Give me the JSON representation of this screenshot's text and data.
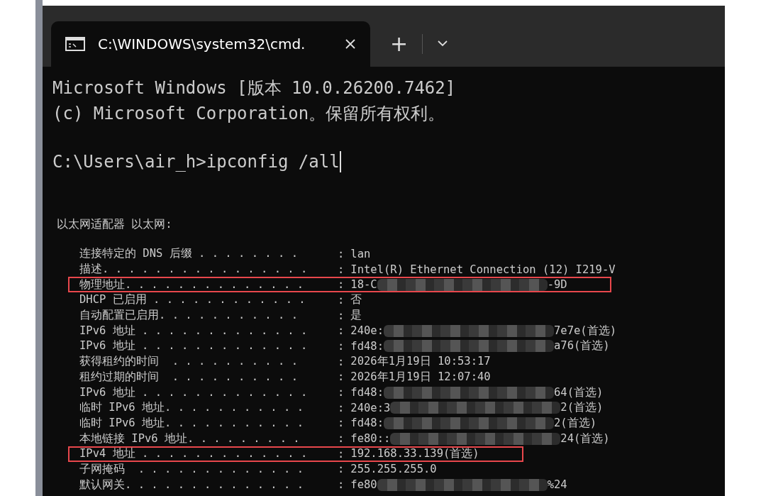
{
  "window": {
    "tab": {
      "title": "C:\\WINDOWS\\system32\\cmd.",
      "selected": true
    },
    "new_tab_button": "+"
  },
  "console": {
    "lines": [
      "Microsoft Windows [版本 10.0.26200.7462]",
      "(c) Microsoft Corporation。保留所有权利。"
    ],
    "prompt": "C:\\Users\\air_h>ipconfig /all"
  },
  "output": {
    "heading": "以太网适配器 以太网:",
    "rows": [
      {
        "label": "连接特定的 DNS 后缀 . . . . . . . .",
        "sep": ":",
        "value": "lan",
        "highlighted": false
      },
      {
        "label": "描述. . . . . . . . . . . . . . . .",
        "sep": ":",
        "value": "Intel(R) Ethernet Connection (12) I219-V",
        "highlighted": false
      },
      {
        "label": "物理地址. . . . . . . . . . . . . .",
        "sep": ":",
        "value": "18-C",
        "value_end": "-9D",
        "redacted": true,
        "highlighted": true
      },
      {
        "label": "DHCP 已启用 . . . . . . . . . . . .",
        "sep": ":",
        "value": "否",
        "highlighted": false
      },
      {
        "label": "自动配置已启用. . . . . . . . . . .",
        "sep": ":",
        "value": "是",
        "highlighted": false
      },
      {
        "label": "IPv6 地址 . . . . . . . . . . . . .",
        "sep": ":",
        "value": "240e:",
        "value_end": "7e7e(首选)",
        "redacted": true,
        "highlighted": false
      },
      {
        "label": "IPv6 地址 . . . . . . . . . . . . .",
        "sep": ":",
        "value": "fd48:",
        "value_end": "a76(首选)",
        "redacted": true,
        "highlighted": false
      },
      {
        "label": "获得租约的时间  . . . . . . . . . .",
        "sep": ":",
        "value": "2026年1月19日 10:53:17",
        "highlighted": false
      },
      {
        "label": "租约过期的时间  . . . . . . . . . .",
        "sep": ":",
        "value": "2026年1月19日 12:07:40",
        "highlighted": false
      },
      {
        "label": "IPv6 地址 . . . . . . . . . . . . .",
        "sep": ":",
        "value": "fd48:",
        "value_end": "64(首选)",
        "redacted": true,
        "highlighted": false
      },
      {
        "label": "临时 IPv6 地址. . . . . . . . . . .",
        "sep": ":",
        "value": "240e:3",
        "value_end": "2(首选)",
        "redacted": true,
        "highlighted": false
      },
      {
        "label": "临时 IPv6 地址. . . . . . . . . . .",
        "sep": ":",
        "value": "fd48:",
        "value_end": "2(首选)",
        "redacted": true,
        "highlighted": false
      },
      {
        "label": "本地链接 IPv6 地址. . . . . . . . .",
        "sep": ":",
        "value": "fe80::",
        "value_end": "24(首选)",
        "redacted": true,
        "highlighted": false
      },
      {
        "label": "IPv4 地址 . . . . . . . . . . . . .",
        "sep": ":",
        "value": "192.168.33.139(首选)",
        "highlighted": true
      },
      {
        "label": "子网掩码  . . . . . . . . . . . . .",
        "sep": ":",
        "value": "255.255.255.0",
        "highlighted": false
      },
      {
        "label": "默认网关. . . . . . . . . . . . . .",
        "sep": ":",
        "value": "fe80",
        "value_end": "%24",
        "redacted": true,
        "highlighted": false
      }
    ]
  }
}
